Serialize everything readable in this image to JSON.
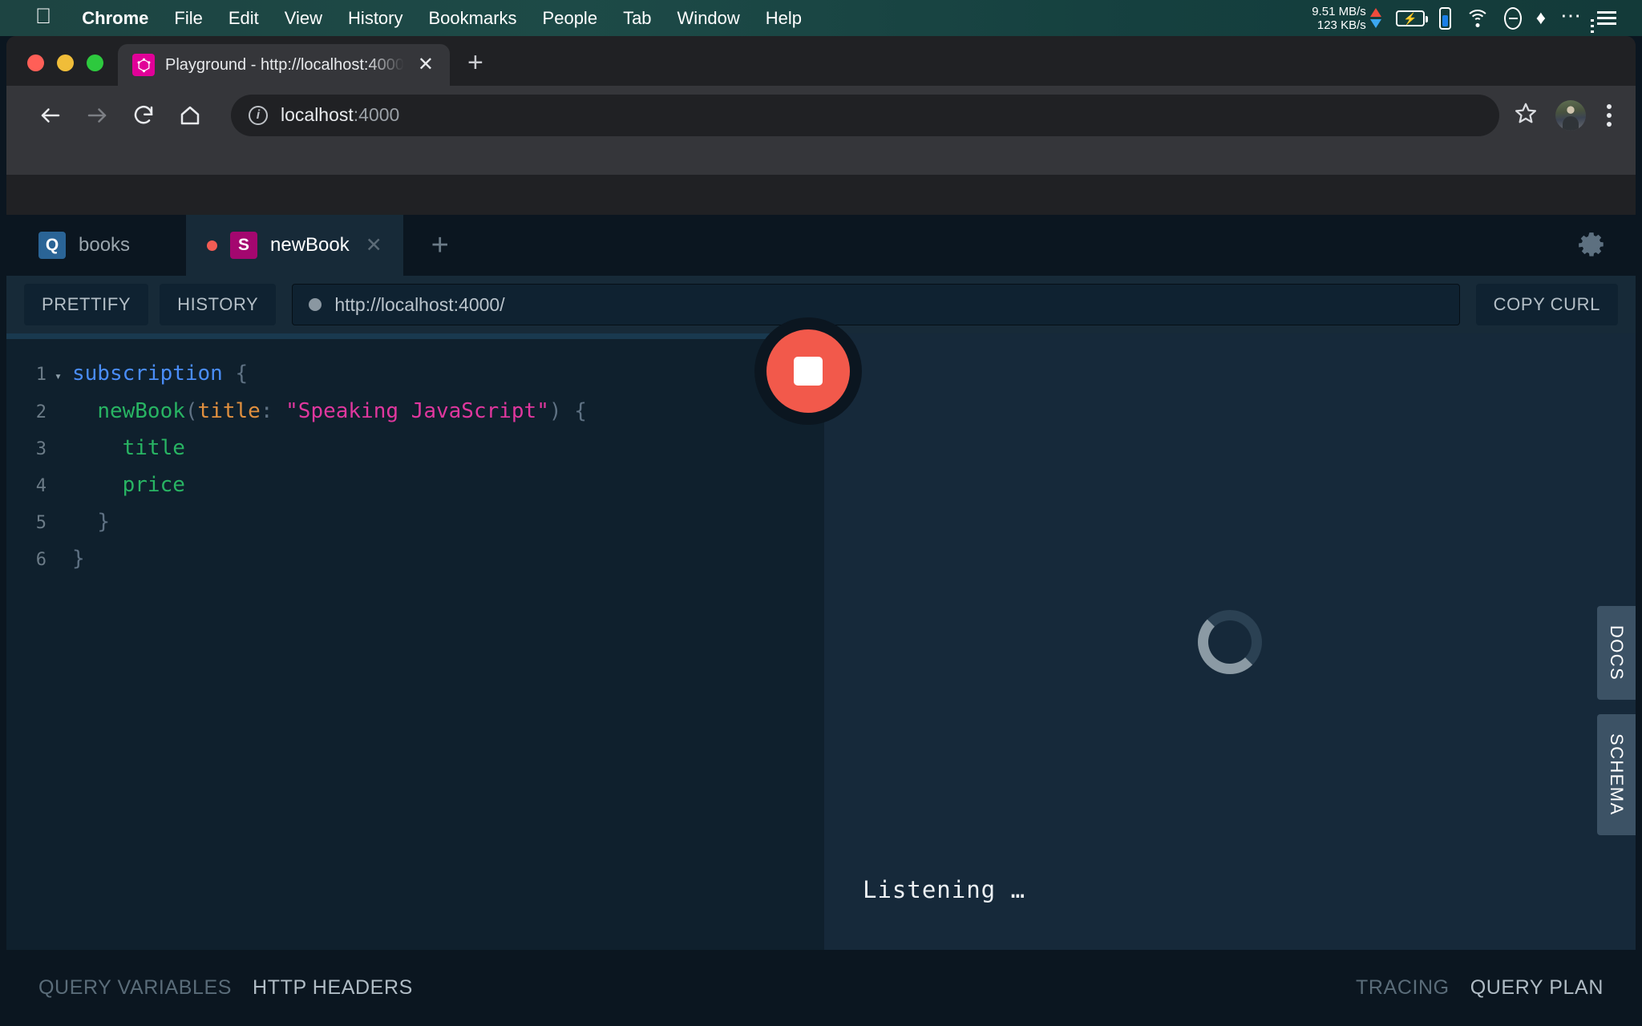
{
  "menubar": {
    "apple_icon": "apple-logo",
    "items": [
      {
        "label": "Chrome",
        "bold": true
      },
      {
        "label": "File",
        "bold": false
      },
      {
        "label": "Edit",
        "bold": false
      },
      {
        "label": "View",
        "bold": false
      },
      {
        "label": "History",
        "bold": false
      },
      {
        "label": "Bookmarks",
        "bold": false
      },
      {
        "label": "People",
        "bold": false
      },
      {
        "label": "Tab",
        "bold": false
      },
      {
        "label": "Window",
        "bold": false
      },
      {
        "label": "Help",
        "bold": false
      }
    ],
    "network": {
      "upload": "9.51 MB/s",
      "download": "123 KB/s",
      "upload_color": "#ee4b3c",
      "download_color": "#3ba7f0"
    },
    "status_icons": [
      "battery-charging-icon",
      "phone-battery-icon",
      "wifi-icon",
      "do-not-disturb-icon",
      "leaf-icon",
      "overflow-dots-icon",
      "control-center-icon"
    ],
    "background_color": "#1d4442"
  },
  "browser": {
    "traffic_lights": [
      "close",
      "minimize",
      "zoom"
    ],
    "tab": {
      "favicon": "graphql-logo-icon",
      "favicon_color": "#e10098",
      "title": "Playground - http://localhost:4000",
      "close_label": "✕"
    },
    "new_tab_label": "+",
    "nav": {
      "back_icon": "back-arrow-icon",
      "forward_icon": "forward-arrow-icon",
      "reload_icon": "reload-icon",
      "home_icon": "home-icon"
    },
    "omnibox": {
      "info_icon": "site-info-icon",
      "host": "localhost",
      "port": ":4000",
      "full_url": "localhost:4000"
    },
    "bookmark_icon": "star-icon",
    "avatar_icon": "profile-avatar",
    "menu_icon": "three-dot-menu-icon"
  },
  "playground": {
    "tabs": [
      {
        "badge": "Q",
        "badge_kind": "query",
        "badge_color": "#2a6496",
        "label": "books",
        "active": false,
        "has_dot": false,
        "closable": false
      },
      {
        "badge": "S",
        "badge_kind": "subscription",
        "badge_color": "#a4076f",
        "label": "newBook",
        "active": true,
        "has_dot": true,
        "dot_color": "#f25c54",
        "closable": true,
        "close_label": "✕"
      }
    ],
    "add_tab_label": "+",
    "settings_icon": "gear-icon",
    "toolbar": {
      "prettify_label": "PRETTIFY",
      "history_label": "HISTORY",
      "endpoint_url": "http://localhost:4000/",
      "copy_curl_label": "COPY CURL"
    },
    "editor": {
      "lines": [
        {
          "num": "1",
          "fold": "▾",
          "tokens": [
            {
              "t": "subscription",
              "c": "kw"
            },
            {
              "t": " ",
              "c": "punc"
            },
            {
              "t": "{",
              "c": "punc"
            }
          ]
        },
        {
          "num": "2",
          "fold": "",
          "tokens": [
            {
              "t": "  ",
              "c": "punc"
            },
            {
              "t": "newBook",
              "c": "field"
            },
            {
              "t": "(",
              "c": "punc"
            },
            {
              "t": "title",
              "c": "arg"
            },
            {
              "t": ":",
              "c": "punc"
            },
            {
              "t": " ",
              "c": "punc"
            },
            {
              "t": "\"Speaking JavaScript\"",
              "c": "str"
            },
            {
              "t": ")",
              "c": "punc"
            },
            {
              "t": " ",
              "c": "punc"
            },
            {
              "t": "{",
              "c": "punc"
            }
          ]
        },
        {
          "num": "3",
          "fold": "",
          "tokens": [
            {
              "t": "    ",
              "c": "punc"
            },
            {
              "t": "title",
              "c": "field"
            }
          ]
        },
        {
          "num": "4",
          "fold": "",
          "tokens": [
            {
              "t": "    ",
              "c": "punc"
            },
            {
              "t": "price",
              "c": "field"
            }
          ]
        },
        {
          "num": "5",
          "fold": "",
          "tokens": [
            {
              "t": "  ",
              "c": "punc"
            },
            {
              "t": "}",
              "c": "punc"
            }
          ]
        },
        {
          "num": "6",
          "fold": "",
          "tokens": [
            {
              "t": "}",
              "c": "punc"
            }
          ]
        }
      ],
      "plain_text": "subscription {\n  newBook(title: \"Speaking JavaScript\") {\n    title\n    price\n  }\n}"
    },
    "execute_button": {
      "icon": "stop-square-icon",
      "state": "running",
      "color": "#f2594b"
    },
    "result": {
      "spinner_icon": "loading-spinner-icon",
      "status_text": "Listening …"
    },
    "side_tabs": [
      {
        "label": "DOCS"
      },
      {
        "label": "SCHEMA"
      }
    ],
    "bottom": {
      "left_tabs": [
        {
          "label": "QUERY VARIABLES",
          "active": false
        },
        {
          "label": "HTTP HEADERS",
          "active": true
        }
      ],
      "right_tabs": [
        {
          "label": "TRACING",
          "active": false
        },
        {
          "label": "QUERY PLAN",
          "active": true
        }
      ]
    }
  }
}
